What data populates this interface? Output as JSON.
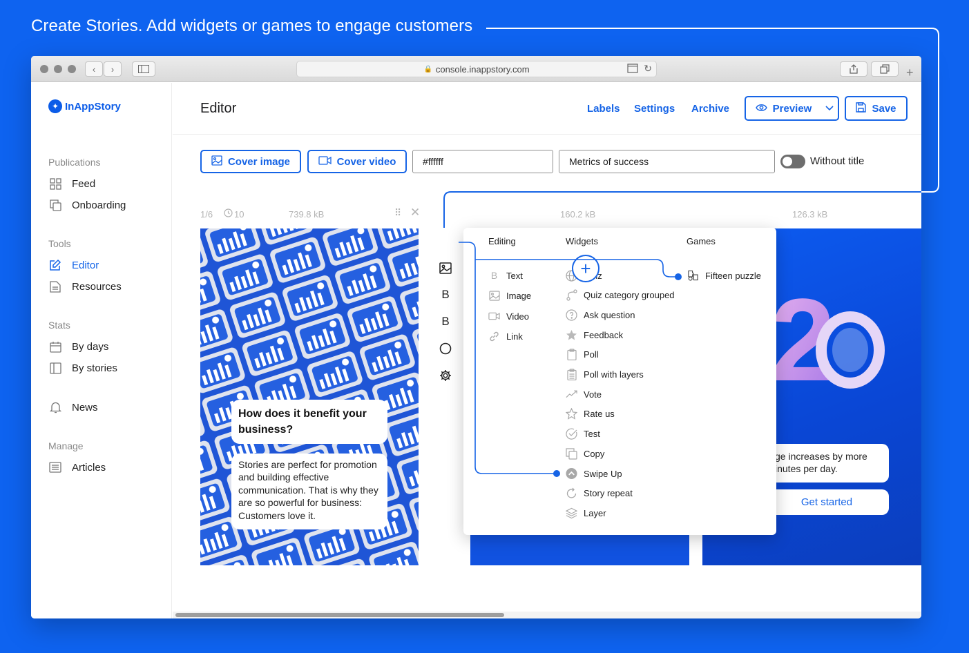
{
  "headline": "Create Stories. Add widgets or games to engage customers",
  "browser": {
    "url": "console.inappstory.com",
    "lock_icon": "lock-icon"
  },
  "brand": {
    "name": "InAppStory",
    "accent": "#1664e6",
    "background": "#0e63f0"
  },
  "sidebar": {
    "publications_title": "Publications",
    "publications": [
      {
        "label": "Feed",
        "icon": "grid-icon"
      },
      {
        "label": "Onboarding",
        "icon": "copy-icon"
      }
    ],
    "tools_title": "Tools",
    "tools": [
      {
        "label": "Editor",
        "icon": "edit-icon",
        "active": true
      },
      {
        "label": "Resources",
        "icon": "document-icon"
      }
    ],
    "stats_title": "Stats",
    "stats": [
      {
        "label": "By days",
        "icon": "calendar-icon"
      },
      {
        "label": "By stories",
        "icon": "columns-icon"
      }
    ],
    "news": {
      "label": "News",
      "icon": "bell-icon"
    },
    "manage_title": "Manage",
    "manage": [
      {
        "label": "Articles",
        "icon": "list-icon"
      }
    ]
  },
  "header": {
    "title": "Editor",
    "links": [
      "Labels",
      "Settings",
      "Archive"
    ],
    "preview_label": "Preview",
    "save_label": "Save"
  },
  "story_toolbar": {
    "cover_image_label": "Cover image",
    "cover_video_label": "Cover video",
    "color_value": "#ffffff",
    "title_value": "Metrics of success",
    "without_title_label": "Without title"
  },
  "slides": [
    {
      "counter": "1/6",
      "duration": "10",
      "size": "739.8 kB"
    },
    {
      "size": "160.2 kB"
    },
    {
      "size": "126.3 kB"
    }
  ],
  "slide1": {
    "question": "How does it benefit your business?",
    "answer": "Stories are perfect for promotion and building effective communication. That is why they are so powerful for business: Customers love it."
  },
  "slide3": {
    "text": "ge increases by more\ninutes per day.",
    "button": "Get started"
  },
  "menu": {
    "editing_title": "Editing",
    "widgets_title": "Widgets",
    "games_title": "Games",
    "editing": [
      {
        "label": "Text",
        "icon": "text-icon"
      },
      {
        "label": "Image",
        "icon": "image-icon"
      },
      {
        "label": "Video",
        "icon": "video-icon"
      },
      {
        "label": "Link",
        "icon": "link-icon"
      }
    ],
    "widgets": [
      {
        "label": "Quiz",
        "icon": "globe-icon"
      },
      {
        "label": "Quiz category grouped",
        "icon": "branch-icon"
      },
      {
        "label": "Ask question",
        "icon": "question-icon"
      },
      {
        "label": "Feedback",
        "icon": "star-filled-icon"
      },
      {
        "label": "Poll",
        "icon": "clipboard-icon"
      },
      {
        "label": "Poll with layers",
        "icon": "clipboard-layers-icon"
      },
      {
        "label": "Vote",
        "icon": "trend-icon"
      },
      {
        "label": "Rate us",
        "icon": "star-icon"
      },
      {
        "label": "Test",
        "icon": "check-circle-icon"
      },
      {
        "label": "Copy",
        "icon": "copy-icon"
      },
      {
        "label": "Swipe Up",
        "icon": "swipe-up-icon"
      },
      {
        "label": "Story repeat",
        "icon": "repeat-icon"
      },
      {
        "label": "Layer",
        "icon": "layers-icon"
      }
    ],
    "games": [
      {
        "label": "Fifteen puzzle",
        "icon": "puzzle-icon"
      }
    ]
  }
}
